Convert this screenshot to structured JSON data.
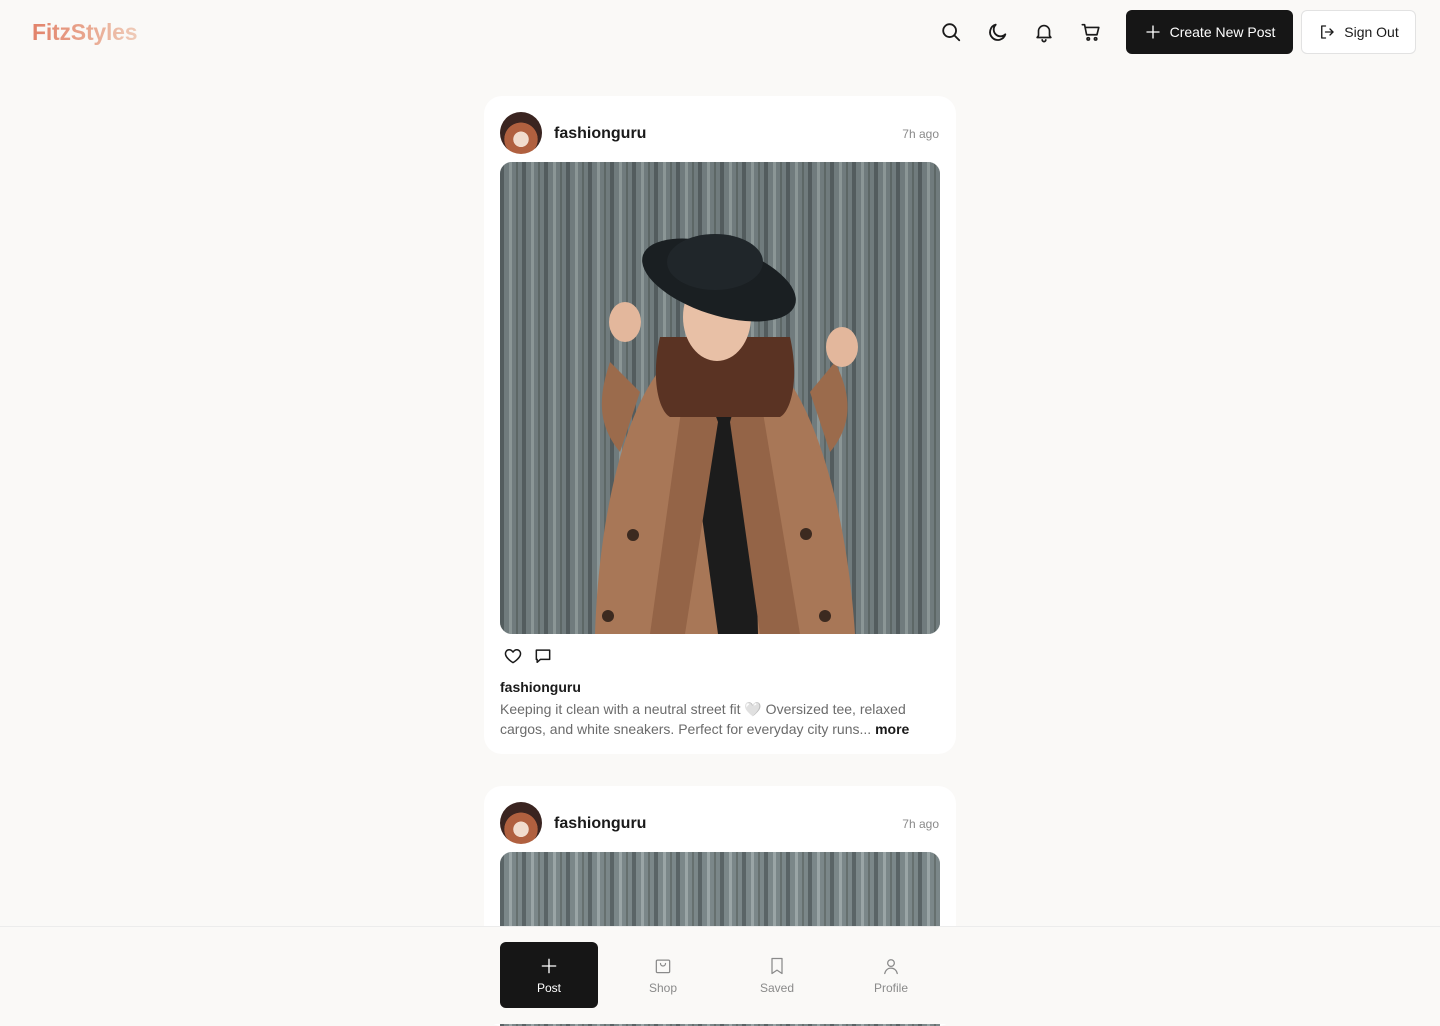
{
  "app": {
    "logo": "FitzStyles"
  },
  "header": {
    "icons": [
      "search-icon",
      "moon-icon",
      "bell-icon",
      "cart-icon"
    ],
    "create_label": "Create New Post",
    "signout_label": "Sign Out"
  },
  "posts": [
    {
      "username": "fashionguru",
      "time": "7h ago",
      "caption_user": "fashionguru",
      "caption": "Keeping it clean with a neutral street fit 🤍 Oversized tee, relaxed cargos, and white sneakers. Perfect for everyday city runs...",
      "more_label": "more"
    },
    {
      "username": "fashionguru",
      "time": "7h ago"
    }
  ],
  "bottom_nav": [
    {
      "label": "Post",
      "icon": "plus-icon",
      "active": true
    },
    {
      "label": "Shop",
      "icon": "shopping-bag-icon",
      "active": false
    },
    {
      "label": "Saved",
      "icon": "bookmark-icon",
      "active": false
    },
    {
      "label": "Profile",
      "icon": "user-icon",
      "active": false
    }
  ],
  "colors": {
    "brand_start": "#e2826a",
    "brand_end": "#efcbb8",
    "primary_button": "#161616",
    "background": "#faf9f7"
  }
}
